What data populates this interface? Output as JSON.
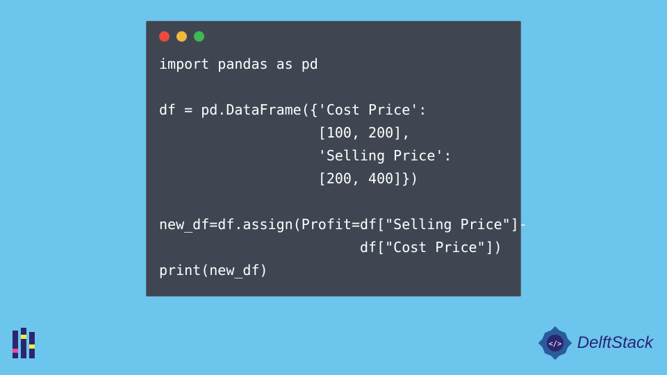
{
  "code": {
    "lines": [
      "import pandas as pd",
      "",
      "df = pd.DataFrame({'Cost Price':",
      "                   [100, 200],",
      "                   'Selling Price':",
      "                   [200, 400]})",
      "",
      "new_df=df.assign(Profit=df[\"Selling Price\"]-",
      "                        df[\"Cost Price\"])",
      "print(new_df)"
    ]
  },
  "brand": {
    "name": "DelftStack"
  },
  "traffic_lights": {
    "red": "#e94b3c",
    "yellow": "#f2b83b",
    "green": "#3fb950"
  }
}
